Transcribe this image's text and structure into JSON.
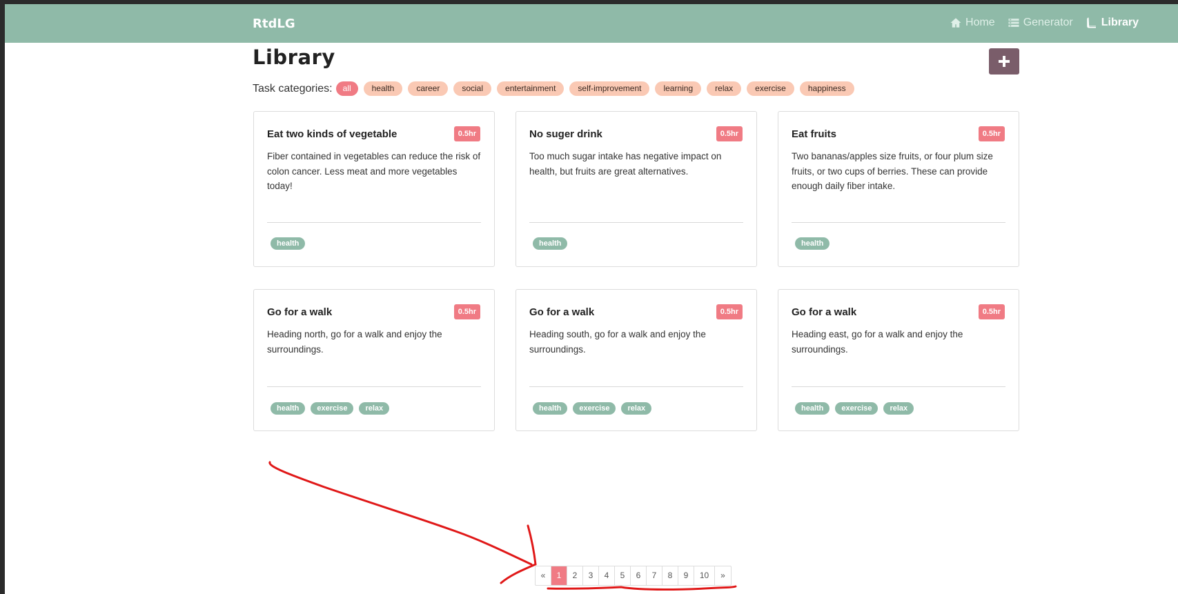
{
  "navbar": {
    "brand": "RtdLG",
    "links": [
      {
        "label": "Home",
        "icon": "home-icon"
      },
      {
        "label": "Generator",
        "icon": "list-icon"
      },
      {
        "label": "Library",
        "icon": "book-icon",
        "active": true
      }
    ]
  },
  "page": {
    "title": "Library",
    "add_button_icon": "plus-icon"
  },
  "categories": {
    "label": "Task categories:",
    "items": [
      "all",
      "health",
      "career",
      "social",
      "entertainment",
      "self-improvement",
      "learning",
      "relax",
      "exercise",
      "happiness"
    ],
    "active": "all"
  },
  "cards": [
    {
      "title": "Eat two kinds of vegetable",
      "duration": "0.5hr",
      "description": "Fiber contained in vegetables can reduce the risk of colon cancer. Less meat and more vegetables today!",
      "tags": [
        "health"
      ]
    },
    {
      "title": "No suger drink",
      "duration": "0.5hr",
      "description": "Too much sugar intake has negative impact on health, but fruits are great alternatives.",
      "tags": [
        "health"
      ]
    },
    {
      "title": "Eat fruits",
      "duration": "0.5hr",
      "description": "Two bananas/apples size fruits, or four plum size fruits, or two cups of berries. These can provide enough daily fiber intake.",
      "tags": [
        "health"
      ]
    },
    {
      "title": "Go for a walk",
      "duration": "0.5hr",
      "description": "Heading north, go for a walk and enjoy the surroundings.",
      "tags": [
        "health",
        "exercise",
        "relax"
      ]
    },
    {
      "title": "Go for a walk",
      "duration": "0.5hr",
      "description": "Heading south, go for a walk and enjoy the surroundings.",
      "tags": [
        "health",
        "exercise",
        "relax"
      ]
    },
    {
      "title": "Go for a walk",
      "duration": "0.5hr",
      "description": "Heading east, go for a walk and enjoy the surroundings.",
      "tags": [
        "health",
        "exercise",
        "relax"
      ]
    }
  ],
  "pagination": {
    "prev": "«",
    "pages": [
      "1",
      "2",
      "3",
      "4",
      "5",
      "6",
      "7",
      "8",
      "9",
      "10"
    ],
    "current": "1",
    "next": "»"
  },
  "colors": {
    "navbar": "#8fbaa8",
    "accent": "#f07b84",
    "category_pill": "#fac9b4",
    "tag_pill": "#8fbaa8",
    "add_button": "#7a5d6a",
    "annotation_ink": "#e01818"
  }
}
